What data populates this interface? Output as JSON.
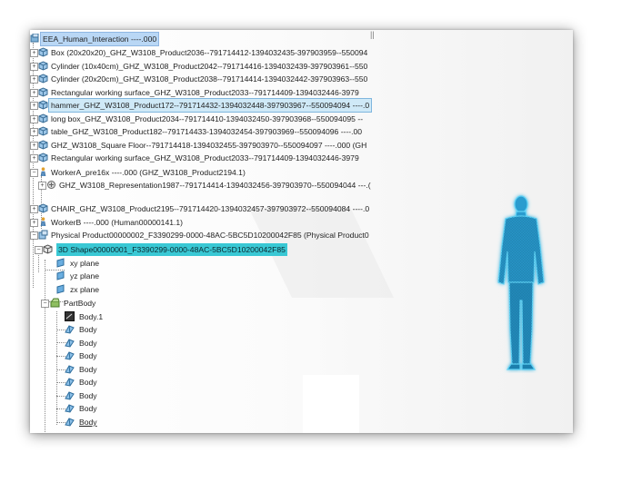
{
  "tree": {
    "root": "EEA_Human_Interaction ----.000",
    "items": [
      "Box (20x20x20)_GHZ_W3108_Product2036--791714412-1394032435-397903959--550094",
      "Cylinder (10x40cm)_GHZ_W3108_Product2042--791714416-1394032439-397903961--550",
      "Cylinder (20x20cm)_GHZ_W3108_Product2038--791714414-1394032442-397903963--550",
      "Rectangular working surface_GHZ_W3108_Product2033--791714409-1394032446-3979",
      "hammer_GHZ_W3108_Product172--791714432-1394032448-397903967--550094094 ----.0",
      "long box_GHZ_W3108_Product2034--791714410-1394032450-397903968--550094095 --",
      "table_GHZ_W3108_Product182--791714433-1394032454-397903969--550094096 ----.00",
      "GHZ_W3108_Square Floor--791714418-1394032455-397903970--550094097 ----.000 (GH",
      "Rectangular working surface_GHZ_W3108_Product2033--791714409-1394032446-3979",
      "WorkerA_pre16x ----.000 (GHZ_W3108_Product2194.1)",
      "GHZ_W3108_Representation1987--791714414-1394032456-397903970--550094044 ---.(",
      "CHAIR_GHZ_W3108_Product2195--791714420-1394032457-397903972--550094084 ----.0",
      "WorkerB ----.000 (Human00000141.1)",
      "Physical Product00000002_F3390299-0000-48AC-5BC5D10200042F85 (Physical Product0",
      "3D Shape00000001_F3390299-0000-48AC-5BC5D10200042F85",
      "xy plane",
      "yz plane",
      "zx plane",
      "PartBody",
      "Body.1",
      "Body",
      "Body",
      "Body",
      "Body",
      "Body",
      "Body",
      "Body",
      "Body"
    ]
  },
  "icons": {
    "root": "assembly-icon",
    "product": "product-cube-icon",
    "worker": "worker-icon",
    "shape": "3d-shape-icon",
    "plane": "plane-icon",
    "partbody": "partbody-icon",
    "body": "body-icon"
  },
  "colors": {
    "selection_blue": "#b9d7f5",
    "selection_teal": "#39c8d4",
    "manikin": "#2aa8dc"
  }
}
